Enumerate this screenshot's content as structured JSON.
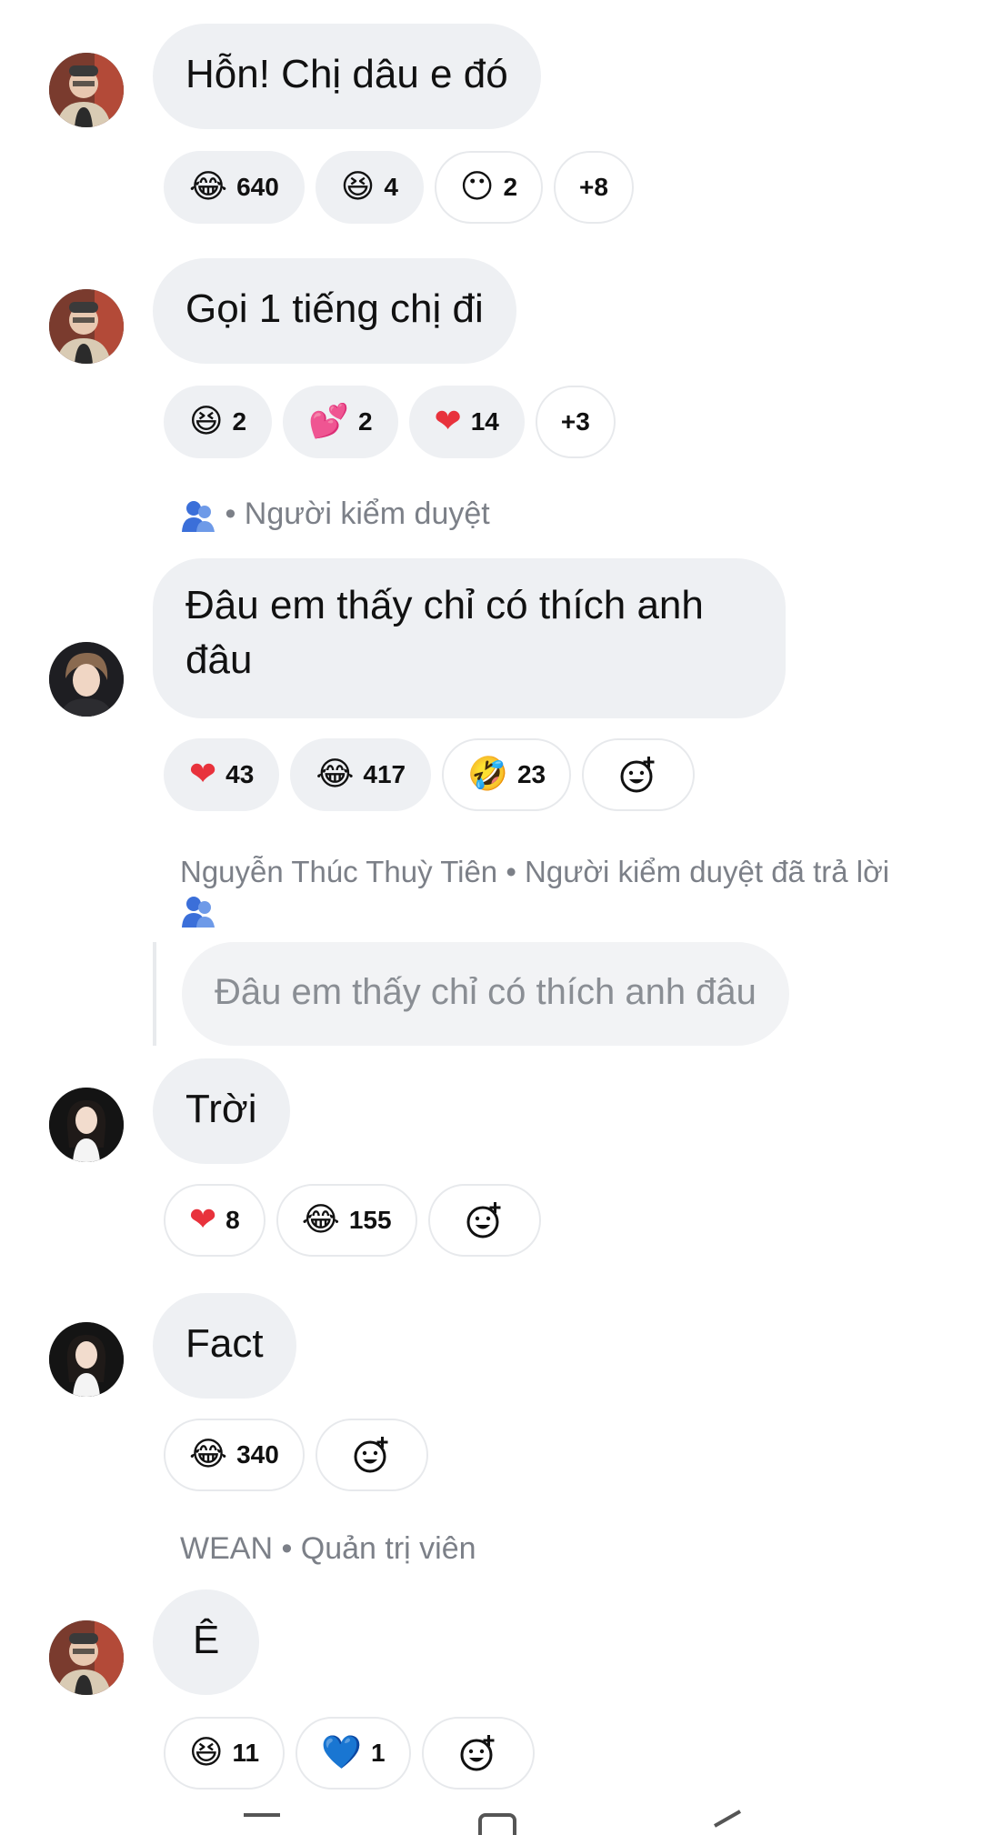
{
  "comments": [
    {
      "text": "Hỗn! Chị dâu e đó",
      "reactions": [
        {
          "icon": "laughing-tears-emoji",
          "glyph": "😂",
          "count": "640"
        },
        {
          "icon": "grinning-squint-emoji",
          "glyph": "😆",
          "count": "4"
        },
        {
          "icon": "no-mouth-emoji",
          "glyph": "😶",
          "count": "2"
        },
        {
          "count": "+8"
        }
      ]
    },
    {
      "text": "Gọi 1 tiếng chị đi",
      "reactions": [
        {
          "icon": "grinning-squint-emoji",
          "glyph": "😆",
          "count": "2"
        },
        {
          "icon": "two-hearts-emoji",
          "glyph": "💕",
          "count": "2"
        },
        {
          "icon": "red-heart-emoji",
          "glyph": "❤",
          "count": "14"
        },
        {
          "count": "+3"
        }
      ]
    },
    {
      "meta": "• Người kiểm duyệt",
      "text": "Đâu em thấy chỉ có thích anh đâu",
      "reactions": [
        {
          "icon": "red-heart-emoji",
          "glyph": "❤",
          "count": "43"
        },
        {
          "icon": "laughing-tears-emoji",
          "glyph": "😂",
          "count": "417"
        },
        {
          "icon": "rolling-laughing-emoji",
          "glyph": "🤣",
          "count": "23"
        }
      ]
    },
    {
      "reply_meta": "Nguyễn Thúc Thuỳ Tiên • Người kiểm duyệt đã trả lời",
      "quote": "Đâu em thấy chỉ có thích anh đâu",
      "text": "Trời",
      "reactions": [
        {
          "icon": "red-heart-emoji",
          "glyph": "❤",
          "count": "8"
        },
        {
          "icon": "laughing-tears-emoji",
          "glyph": "😂",
          "count": "155"
        }
      ]
    },
    {
      "text": "Fact",
      "reactions": [
        {
          "icon": "laughing-tears-emoji",
          "glyph": "😂",
          "count": "340"
        }
      ]
    },
    {
      "meta": "WEAN • Quản trị viên",
      "text": "Ê",
      "reactions": [
        {
          "icon": "grinning-squint-emoji",
          "glyph": "😆",
          "count": "11"
        },
        {
          "icon": "blue-heart-emoji",
          "glyph": "💙",
          "count": "1"
        }
      ]
    }
  ],
  "colors": {
    "bubble": "#eef0f3",
    "meta_text": "#7c8088",
    "moderator_icon": "#3b6fd9",
    "heart": "#e8323c"
  }
}
